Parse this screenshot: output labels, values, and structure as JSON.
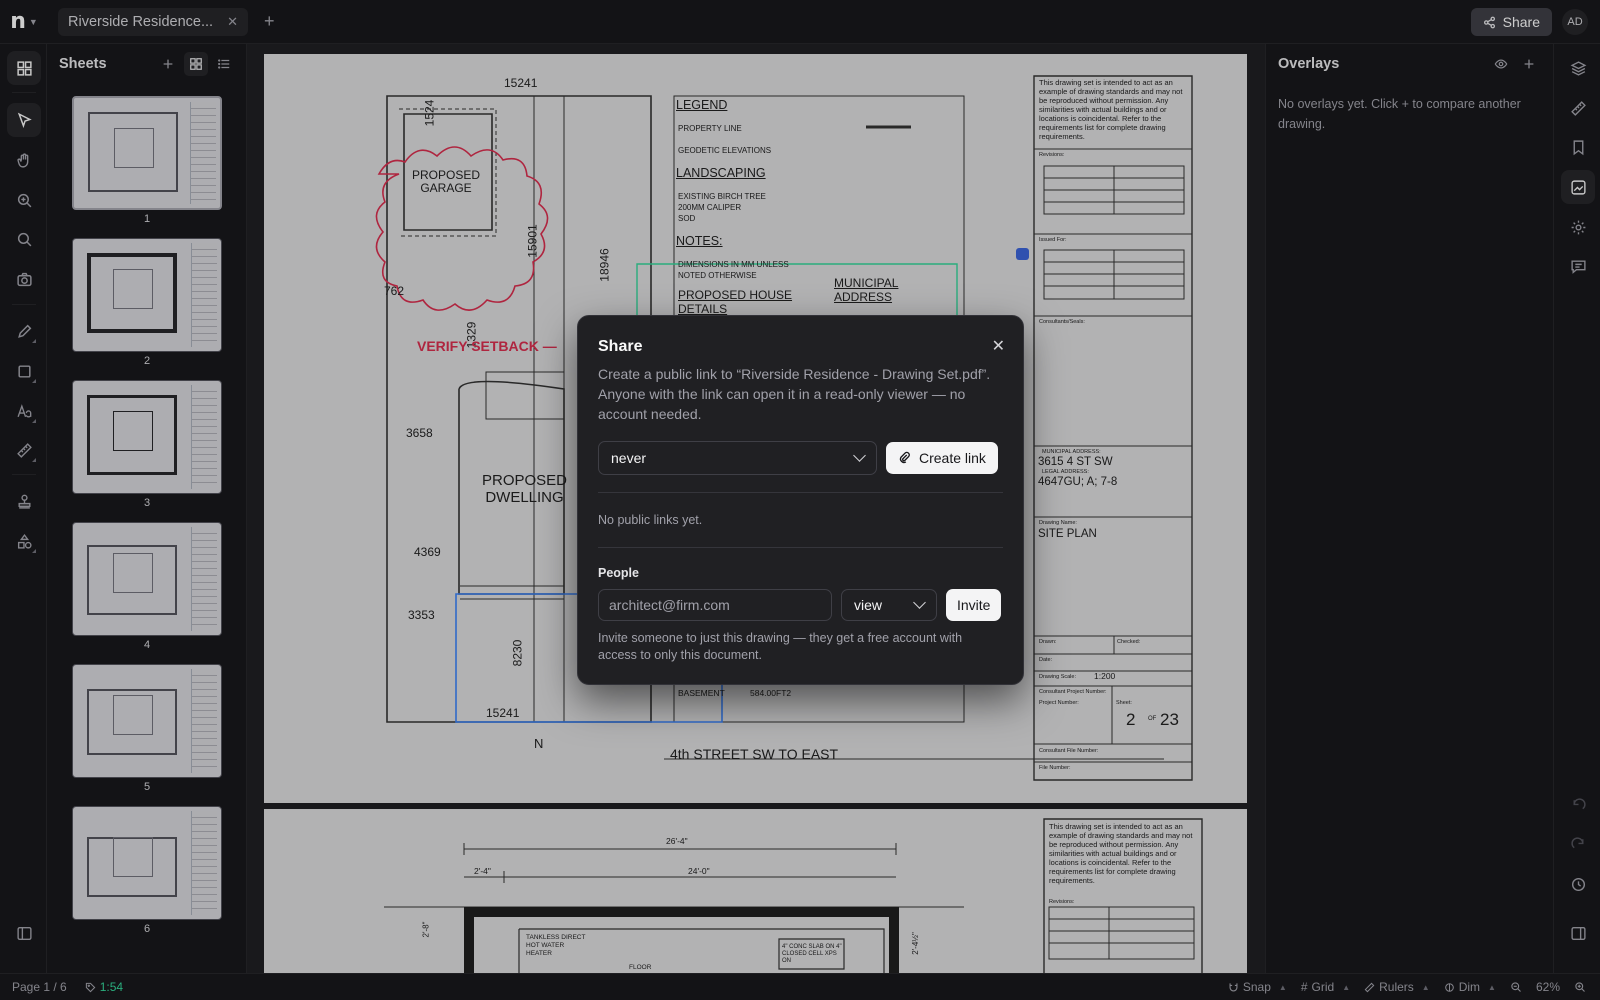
{
  "app": {
    "logo_text": "n"
  },
  "tabs": [
    {
      "title": "Riverside Residence..."
    }
  ],
  "header": {
    "share_label": "Share",
    "avatar_initials": "AD"
  },
  "sheets_panel": {
    "title": "Sheets",
    "thumbnails": [
      {
        "num": "1"
      },
      {
        "num": "2"
      },
      {
        "num": "3"
      },
      {
        "num": "4"
      },
      {
        "num": "5"
      },
      {
        "num": "6"
      }
    ]
  },
  "drawing": {
    "dims": {
      "top": "15241",
      "left1": "1524",
      "garage_depth": "15901",
      "right": "18946",
      "d762": "762",
      "d3658": "3658",
      "d4369": "4369",
      "d3353": "3353",
      "d8230": "8230",
      "bottom": "15241",
      "d1329": "1329"
    },
    "garage": "PROPOSED\nGARAGE",
    "verify": "VERIFY SETBACK —",
    "dwelling": "PROPOSED\nDWELLING",
    "street": "4th STREET SW TO EAST",
    "north": "N",
    "legend": {
      "title": "LEGEND",
      "property_line": "PROPERTY LINE",
      "geodetic": "GEODETIC ELEVATIONS",
      "landscaping": "LANDSCAPING",
      "birch": "EXISTING BIRCH TREE",
      "caliper": "200MM CALIPER",
      "sod": "SOD",
      "notes": "NOTES:",
      "dims_note": "DIMENSIONS IN MM UNLESS",
      "noted": "NOTED OTHERWISE",
      "house_details": "PROPOSED HOUSE",
      "details": "DETAILS",
      "municipal": "MUNICIPAL",
      "address": "ADDRESS",
      "basement": "BASEMENT",
      "area": "584.00FT2"
    },
    "titleblock": {
      "disclaimer": "This drawing set is intended to act as an example of drawing standards and may not be reproduced without permission. Any similarities with actual buildings and or locations is coincidental. Refer to the requirements list for complete drawing requirements.",
      "revisions": "Revisions:",
      "issued_for": "Issued For:",
      "consultants": "Consultants/Seals:",
      "municipal_label": "MUNICIPAL ADDRESS:",
      "municipal_value": "3615 4 ST SW",
      "legal_label": "LEGAL ADDRESS:",
      "legal_value": "4647GU; A; 7-8",
      "drawing_name_label": "Drawing Name:",
      "drawing_name": "SITE PLAN",
      "drawn": "Drawn:",
      "checked": "Checked:",
      "date": "Date:",
      "scale_label": "Drawing Scale:",
      "scale": "1:200",
      "cpn": "Consultant Project Number:",
      "project_number": "Project Number:",
      "sheet_label": "Sheet:",
      "sheet": "2",
      "of": "OF",
      "total": "23",
      "cfn": "Consultant File Number:",
      "file_number": "File Number:"
    },
    "sheet2": {
      "d1": "26'-4\"",
      "d2": "2'-4\"",
      "d3": "24'-0\"",
      "tankless": "TANKLESS DIRECT HOT WATER HEATER",
      "floor": "FLOOR",
      "slab": "4\" CONC SLAB ON 4\" CLOSED CELL XPS ON",
      "d4": "2'-8\"",
      "d5": "2'-4½\""
    }
  },
  "overlays_panel": {
    "title": "Overlays",
    "empty_text": "No overlays yet. Click + to compare another drawing."
  },
  "status": {
    "page": "Page 1 / 6",
    "timer": "1:54",
    "snap": "Snap",
    "grid": "Grid",
    "rulers": "Rulers",
    "dim": "Dim",
    "zoom": "62%"
  },
  "share_modal": {
    "title": "Share",
    "description": "Create a public link to “Riverside Residence - Drawing Set.pdf”. Anyone with the link can open it in a read-only viewer — no account needed.",
    "expiry_value": "never",
    "create_link_label": "Create link",
    "no_links": "No public links yet.",
    "people_label": "People",
    "email_placeholder": "architect@firm.com",
    "role_value": "view",
    "invite_label": "Invite",
    "help_text": "Invite someone to just this drawing — they get a free account with access to only this document."
  }
}
